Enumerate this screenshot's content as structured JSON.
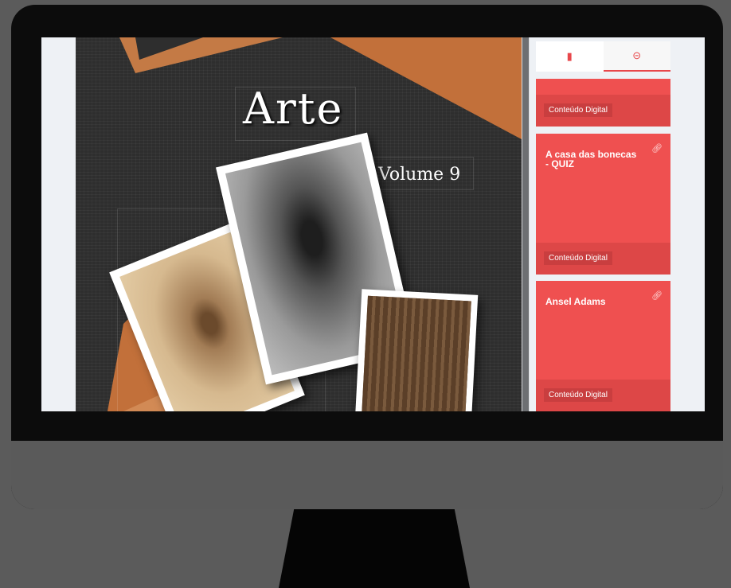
{
  "cover": {
    "title": "Arte",
    "volume": "Volume 9"
  },
  "sidebar": {
    "tabs": [
      {
        "icon": "book-icon",
        "glyph": "▮"
      },
      {
        "icon": "link-icon",
        "glyph": "⊝"
      }
    ],
    "cards": [
      {
        "name": "",
        "tag": "Conteúdo Digital"
      },
      {
        "name": "A casa das bonecas - QUIZ",
        "tag": "Conteúdo Digital",
        "icon": "link-icon"
      },
      {
        "name": "Ansel Adams",
        "tag": "Conteúdo Digital",
        "icon": "link-icon"
      }
    ]
  },
  "colors": {
    "accent": "#ef5050",
    "accent_dark": "#dd4747",
    "cover_bg": "#2e2e2e",
    "orange": "#c2703a"
  }
}
